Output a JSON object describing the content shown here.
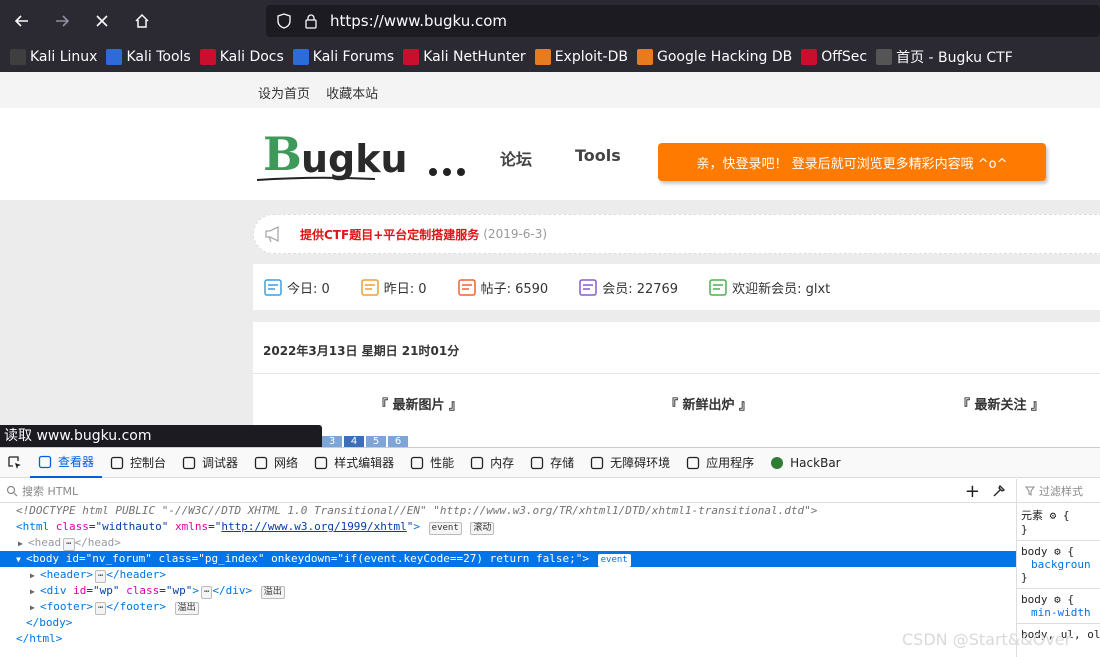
{
  "browser": {
    "url": "https://www.bugku.com",
    "bookmarks": [
      {
        "label": "Kali Linux",
        "color": "#3f3f3f"
      },
      {
        "label": "Kali Tools",
        "color": "#2d6bd8"
      },
      {
        "label": "Kali Docs",
        "color": "#c8102e"
      },
      {
        "label": "Kali Forums",
        "color": "#2d6bd8"
      },
      {
        "label": "Kali NetHunter",
        "color": "#c8102e"
      },
      {
        "label": "Exploit-DB",
        "color": "#e87b1e"
      },
      {
        "label": "Google Hacking DB",
        "color": "#e87b1e"
      },
      {
        "label": "OffSec",
        "color": "#c8102e"
      },
      {
        "label": "首页 - Bugku CTF",
        "color": "#555555"
      }
    ],
    "status_tip": "读取 www.bugku.com"
  },
  "page": {
    "top_links": [
      "设为首页",
      "收藏本站"
    ],
    "menu": [
      "论坛",
      "Tools"
    ],
    "login_banner": "亲，快登录吧！ 登录后就可浏览更多精彩内容哦 ^o^",
    "notice": {
      "message": "提供CTF题目+平台定制搭建服务",
      "date": "(2019-6-3)"
    },
    "stats": [
      {
        "label": "今日: 0",
        "icon": "calendar-today-icon",
        "color": "#3aa0e0"
      },
      {
        "label": "昨日: 0",
        "icon": "calendar-yesterday-icon",
        "color": "#f0a030"
      },
      {
        "label": "帖子: 6590",
        "icon": "post-icon",
        "color": "#f06030"
      },
      {
        "label": "会员: 22769",
        "icon": "member-icon",
        "color": "#8a5cd0"
      },
      {
        "label": "欢迎新会员: glxt",
        "icon": "user-icon",
        "color": "#4cb050"
      }
    ],
    "date_line": "2022年3月13日 星期日 21时01分",
    "columns": [
      "『 最新图片 』",
      "『 新鲜出炉 』",
      "『 最新关注 』"
    ],
    "pager": [
      "3",
      "4",
      "5",
      "6"
    ]
  },
  "devtools": {
    "tabs": [
      {
        "label": "查看器",
        "icon": "inspector-icon",
        "active": true
      },
      {
        "label": "控制台",
        "icon": "console-icon"
      },
      {
        "label": "调试器",
        "icon": "debugger-icon"
      },
      {
        "label": "网络",
        "icon": "network-icon"
      },
      {
        "label": "样式编辑器",
        "icon": "style-editor-icon"
      },
      {
        "label": "性能",
        "icon": "performance-icon"
      },
      {
        "label": "内存",
        "icon": "memory-icon"
      },
      {
        "label": "存储",
        "icon": "storage-icon"
      },
      {
        "label": "无障碍环境",
        "icon": "accessibility-icon"
      },
      {
        "label": "应用程序",
        "icon": "application-icon"
      },
      {
        "label": "HackBar",
        "icon": "hackbar-icon"
      }
    ],
    "search_placeholder": "搜索 HTML",
    "filter_placeholder": "过滤样式",
    "doctype": "<!DOCTYPE html PUBLIC \"-//W3C//DTD XHTML 1.0 Transitional//EN\" \"http://www.w3.org/TR/xhtml1/DTD/xhtml1-transitional.dtd\">",
    "html_class": "widthauto",
    "html_xmlns": "http://www.w3.org/1999/xhtml",
    "body_attrs": {
      "id": "nv_forum",
      "class": "pg_index",
      "onkeydown": "if(event.keyCode==27) return false;"
    },
    "badges": {
      "event": "event",
      "scroll": "滚动",
      "overflow": "溢出"
    },
    "rules": {
      "element": "元素",
      "body": "body",
      "background": "backgroun",
      "min_width": "min-width",
      "body_ul": "body, ul, ol"
    }
  },
  "watermark": "CSDN @Start&&Over"
}
